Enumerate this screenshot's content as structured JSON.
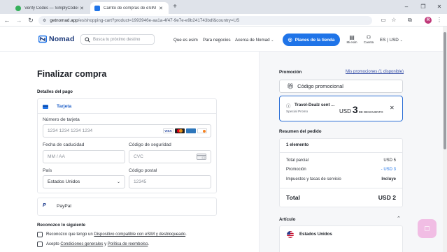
{
  "browser": {
    "tabs": [
      {
        "title": "Verify Codes — SimplyCodes",
        "active": false
      },
      {
        "title": "Carrito de compras de eSIM de",
        "active": true
      }
    ],
    "new_tab": "+",
    "window_controls": {
      "minimize": "–",
      "restore": "❐",
      "close": "✕"
    },
    "url_host": "getnomad.app",
    "url_path": "/es/shopping-cart?product=1993946e-aa1a-4f47-9e7e-e9b241743bdf&country=US",
    "profile_initial": "R"
  },
  "header": {
    "brand": "Nomad",
    "search_placeholder": "Busca tu próximo destino",
    "nav": [
      "Que es esim",
      "Para negocios",
      "Acerca de Nomad"
    ],
    "cta_label": "Planes de la tienda",
    "mi_esim_label": "Mi esim",
    "cuenta_label": "Cuenta",
    "lang_currency": "ES | USD"
  },
  "checkout": {
    "title": "Finalizar compra",
    "payment_details_label": "Detalles del pago",
    "card_method_label": "Tarjeta",
    "card_number_label": "Número de tarjeta",
    "card_number_placeholder": "1234 1234 1234 1234",
    "card_brands": [
      "VISA",
      "MC",
      "AMEX",
      "DISCOVER"
    ],
    "expiry_label": "Fecha de caducidad",
    "expiry_placeholder": "MM / AA",
    "cvc_label": "Código de seguridad",
    "cvc_placeholder": "CVC",
    "country_label": "País",
    "country_value": "Estados Unidos",
    "postal_label": "Código postal",
    "postal_placeholder": "12345",
    "paypal_label": "PayPal",
    "acknowledge_label": "Reconozco lo siguiente",
    "consent1_prefix": "Reconozco que tengo un ",
    "consent1_link": "Dispositivo compatible con eSIM y desbloqueado",
    "consent1_suffix": ".",
    "consent2_prefix": "Acepto ",
    "consent2_link1": "Condiciones generales",
    "consent2_mid": " y ",
    "consent2_link2": "Política de reembolso",
    "consent2_suffix": "."
  },
  "sidebar": {
    "promo_title": "Promoción",
    "promo_link": "Mis promociones (1 disponible)",
    "promo_field_label": "Código promocional",
    "promo_code_name": "Travel-Dealz sent ...",
    "promo_code_sub": "Special Promo",
    "promo_amount_prefix": "USD",
    "promo_amount_value": "3",
    "promo_amount_suffix": "DE DESCUENTO",
    "summary_title": "Resumen del pedido",
    "item_count": "1 elemento",
    "rows": [
      {
        "label": "Total parcial",
        "value": "USD 5"
      },
      {
        "label": "Promoción",
        "value": "- USD 3"
      },
      {
        "label": "Impuestos y tasas de servicio",
        "value": "Incluye"
      }
    ],
    "total_label": "Total",
    "total_value": "USD 2",
    "article_title": "Artículo",
    "article_country": "Estados Unidos"
  },
  "colors": {
    "accent": "#1f74e8",
    "brand": "#1d3a7a",
    "promo_border": "#2c6fd6",
    "discount": "#1f74e8"
  }
}
